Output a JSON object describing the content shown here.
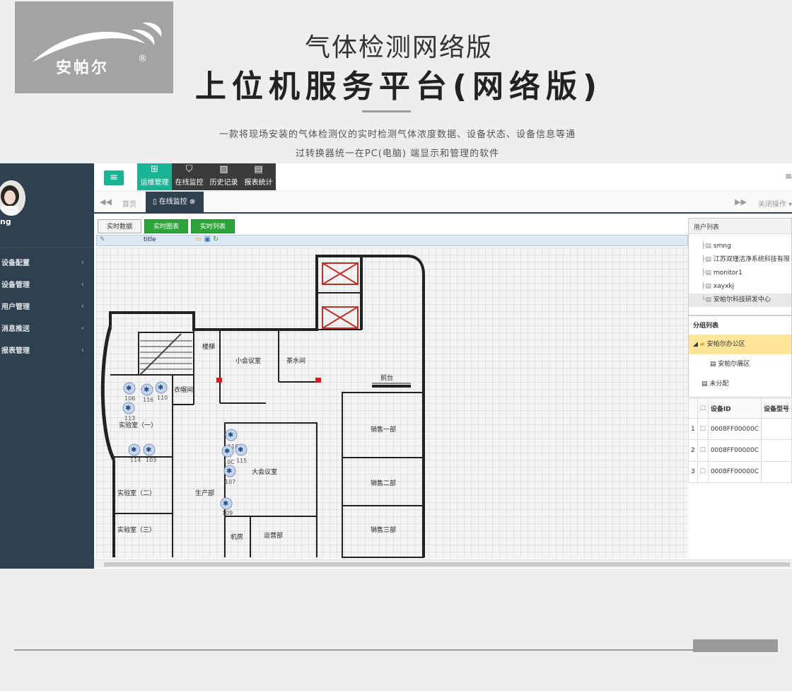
{
  "brand": {
    "logo_text": "安帕尔",
    "logo_mark": "®"
  },
  "hero": {
    "title_line1": "气体检测网络版",
    "title_line2": "上位机服务平台(网络版)",
    "desc_line1": "一款将现场安装的气体检测仪的实时检测气体浓度数据、设备状态、设备信息等通",
    "desc_line2": "过转换器统一在PC(电脑) 端显示和管理的软件"
  },
  "sidebar": {
    "username": "ng",
    "menu": [
      {
        "label": "设备配置"
      },
      {
        "label": "设备管理"
      },
      {
        "label": "用户管理"
      },
      {
        "label": "消息推送"
      },
      {
        "label": "报表管理"
      }
    ]
  },
  "topnav": {
    "menu_icon": "≡",
    "items": [
      {
        "label": "运维管理",
        "icon": "grid-icon"
      },
      {
        "label": "在线监控",
        "icon": "badge-icon"
      },
      {
        "label": "历史记录",
        "icon": "chart-icon"
      },
      {
        "label": "报表统计",
        "icon": "doc-icon"
      }
    ],
    "right_icon": "≡"
  },
  "tabs": {
    "home": "首页",
    "active": "在线监控",
    "close_ops": "关闭操作"
  },
  "subtabs": [
    "实时数据",
    "实时图表",
    "实时列表"
  ],
  "toolbar": {
    "title": "title"
  },
  "floorplan": {
    "rooms": {
      "stairs": "楼梯",
      "small_meeting": "小会议室",
      "tea_room": "茶水间",
      "front_desk": "前台",
      "cloakroom": "衣帽间",
      "lab1": "实验室（一）",
      "lab2": "实验室（二）",
      "lab3": "实验室（三）",
      "production": "生产部",
      "big_meeting": "大会议室",
      "machine_room": "机房",
      "operations": "运营部",
      "sales1": "销售一部",
      "sales2": "销售二部",
      "sales3": "销售三部"
    },
    "sensors": [
      {
        "id": "106"
      },
      {
        "id": "116"
      },
      {
        "id": "110"
      },
      {
        "id": "113"
      },
      {
        "id": "114"
      },
      {
        "id": "103"
      },
      {
        "id": "118"
      },
      {
        "id": "10C"
      },
      {
        "id": "115"
      },
      {
        "id": "107"
      },
      {
        "id": "109"
      }
    ]
  },
  "user_panel": {
    "title": "用户列表",
    "users": [
      "smng",
      "江苏双瑾洁净系统科技有限",
      "monitor1",
      "xayxkj",
      "安帕尔科技研发中心"
    ]
  },
  "group_panel": {
    "title": "分组列表",
    "group": "安帕尔办公区",
    "child": "安帕尔展区",
    "other": "未分配"
  },
  "device_table": {
    "col_id": "设备ID",
    "col_model": "设备型号",
    "rows": [
      {
        "n": "1",
        "id": "0008FF00000C"
      },
      {
        "n": "2",
        "id": "0008FF00000C"
      },
      {
        "n": "3",
        "id": "0008FF00000C"
      }
    ]
  }
}
